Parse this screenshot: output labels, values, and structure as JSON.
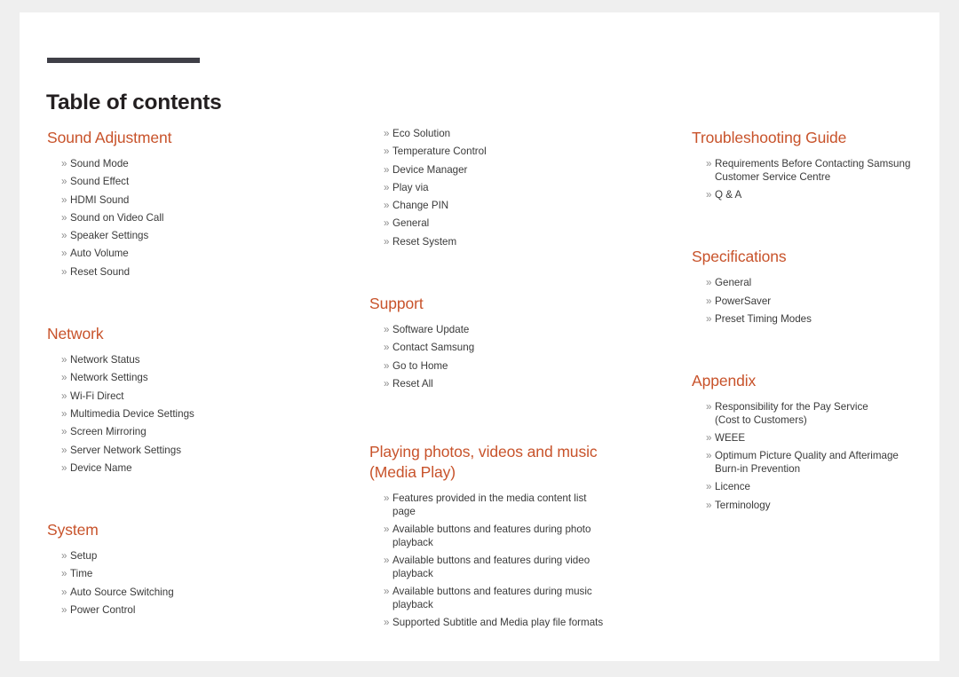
{
  "document": {
    "title": "Table of contents",
    "bullet_glyph": "»",
    "accent_color": "#c8532b",
    "rule_color": "#3f3f47",
    "body_color": "#3a3a3a",
    "page_background": "#ffffff",
    "canvas_background": "#efefef"
  },
  "columns": [
    {
      "name": "column-1",
      "sections": [
        {
          "heading": "Sound Adjustment",
          "items": [
            [
              "Sound Mode"
            ],
            [
              "Sound Effect"
            ],
            [
              "HDMI Sound"
            ],
            [
              "Sound on Video Call"
            ],
            [
              "Speaker Settings"
            ],
            [
              "Auto Volume"
            ],
            [
              "Reset Sound"
            ]
          ]
        },
        {
          "heading": "Network",
          "items": [
            [
              "Network Status"
            ],
            [
              "Network Settings"
            ],
            [
              "Wi-Fi Direct"
            ],
            [
              "Multimedia Device Settings"
            ],
            [
              "Screen Mirroring"
            ],
            [
              "Server Network Settings"
            ],
            [
              "Device Name"
            ]
          ]
        },
        {
          "heading": "System",
          "items": [
            [
              "Setup"
            ],
            [
              "Time"
            ],
            [
              "Auto Source Switching"
            ],
            [
              "Power Control"
            ]
          ]
        }
      ]
    },
    {
      "name": "column-2",
      "sections": [
        {
          "heading": "",
          "items": [
            [
              "Eco Solution"
            ],
            [
              "Temperature Control"
            ],
            [
              "Device Manager"
            ],
            [
              "Play via"
            ],
            [
              "Change PIN"
            ],
            [
              "General"
            ],
            [
              "Reset System"
            ]
          ]
        },
        {
          "heading": "Support",
          "items": [
            [
              "Software Update"
            ],
            [
              "Contact Samsung"
            ],
            [
              "Go to Home"
            ],
            [
              "Reset All"
            ]
          ]
        },
        {
          "heading": "Playing photos, videos and music (Media Play)",
          "items": [
            [
              "Features provided in the media content list",
              "page"
            ],
            [
              "Available buttons and features during photo",
              "playback"
            ],
            [
              "Available buttons and features during video",
              "playback"
            ],
            [
              "Available buttons and features during music",
              "playback"
            ],
            [
              "Supported Subtitle and Media play file formats"
            ]
          ]
        }
      ]
    },
    {
      "name": "column-3",
      "sections": [
        {
          "heading": "Troubleshooting Guide",
          "items": [
            [
              "Requirements Before Contacting Samsung",
              "Customer Service Centre"
            ],
            [
              "Q & A"
            ]
          ]
        },
        {
          "heading": "Specifications",
          "items": [
            [
              "General"
            ],
            [
              "PowerSaver"
            ],
            [
              "Preset Timing Modes"
            ]
          ]
        },
        {
          "heading": "Appendix",
          "items": [
            [
              "Responsibility for the Pay Service",
              "(Cost to Customers)"
            ],
            [
              "WEEE"
            ],
            [
              "Optimum Picture Quality and Afterimage",
              "Burn-in Prevention"
            ],
            [
              "Licence"
            ],
            [
              "Terminology"
            ]
          ]
        }
      ]
    }
  ]
}
